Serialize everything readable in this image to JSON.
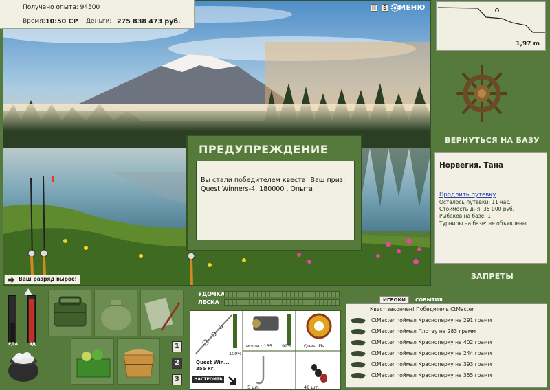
{
  "stats": {
    "xp_label": "Получено опыта:",
    "xp_value": "94500",
    "time_label": "Время:",
    "time_value": "10:50 СР",
    "money_label": "Деньги:",
    "money_value": "275 838 473 руб."
  },
  "top_icons": {
    "pause": "II",
    "sound": "S",
    "menu": "МЕНЮ"
  },
  "depth": {
    "value": "1,97 m"
  },
  "right": {
    "return_label": "ВЕРНУТЬСЯ НА БАЗУ",
    "location": "Норвегия. Тана",
    "extend_link": "Продлить путевку",
    "remaining": "Осталось путевки: 11 час.",
    "day_cost": "Стоимость дня: 35 000 руб.",
    "fishers": "Рыбаков на базе: 1",
    "tournaments": "Турниры на базе: не объявлены",
    "bans_label": "ЗАПРЕТЫ"
  },
  "dialog": {
    "title": "ПРЕДУПРЕЖДЕНИЕ",
    "message": "Вы стали победителем квеста! Ваш приз: Quest Winners-4, 180000 , Опыта"
  },
  "rank": {
    "text": "Ваш разряд вырос!"
  },
  "meters": {
    "food_label": "ЕДА",
    "poison_label": "ЯД"
  },
  "pages": [
    "1",
    "2",
    "3"
  ],
  "tackle": {
    "rod_label": "УДОЧКА",
    "line_label": "ЛЕСКА",
    "rod_name": "Quest Win...",
    "rod_weight": "355 кг",
    "rod_percent": "100%",
    "tune_button": "НАСТРОИТЬ",
    "reel_power": "мощн.: 135",
    "reel_percent": "99%",
    "line_name": "Quest Fis...",
    "hooks_count": "5 шт.",
    "bait_count": "48 шт."
  },
  "events": {
    "tabs": [
      "ИГРОКИ",
      "СОБЫТИЯ"
    ],
    "active_tab": "ИГРОКИ",
    "header": "Квест закончен! Победитель CtMacter",
    "items": [
      "CtMacter поймал Красноперку на 291 грамм",
      "CtMacter поймал Плотву на 283 грамм",
      "CtMacter поймал Красноперку на 402 грамм",
      "CtMacter поймал Красноперку на 244 грамм",
      "CtMacter поймал Красноперку на 393 грамм",
      "CtMacter поймал Красноперку на 355 грамм"
    ]
  },
  "colors": {
    "panel_green": "#557a3b",
    "cream": "#f1f0e2",
    "dark_green": "#36521f"
  }
}
